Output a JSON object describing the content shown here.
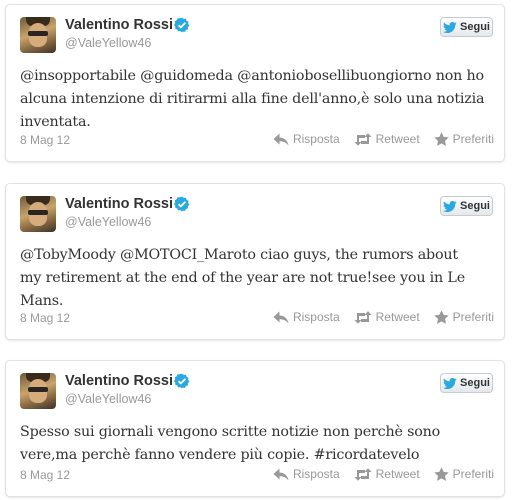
{
  "colors": {
    "name": "#333333",
    "handle": "#999999",
    "verified": "#2aa9e0",
    "bird": "#2aa9e0",
    "action": "#999999",
    "card_border": "#dfe3e8"
  },
  "icons": {
    "verified": "verified-badge-icon",
    "follow": "twitter-bird-icon",
    "reply": "reply-arrow-icon",
    "retweet": "retweet-icon",
    "favorite": "star-icon"
  },
  "tweets": [
    {
      "name": "Valentino Rossi",
      "handle": "@ValeYellow46",
      "follow_label": "Segui",
      "text_lines": [
        "@insopportabile @guidomeda @antoniobosellibuongiorno non ho",
        "alcuna intenzione di ritirarmi alla fine dell'anno,è solo una notizia",
        "inventata."
      ],
      "date": "8 Mag 12",
      "reply_label": "Risposta",
      "retweet_label": "Retweet",
      "favorite_label": "Preferiti"
    },
    {
      "name": "Valentino Rossi",
      "handle": "@ValeYellow46",
      "follow_label": "Segui",
      "text_lines": [
        "@TobyMoody @MOTOCI_Maroto ciao guys, the rumors about",
        "my retirement at the end of the year are not true!see you in Le",
        "Mans."
      ],
      "date": "8 Mag 12",
      "reply_label": "Risposta",
      "retweet_label": "Retweet",
      "favorite_label": "Preferiti"
    },
    {
      "name": "Valentino Rossi",
      "handle": "@ValeYellow46",
      "follow_label": "Segui",
      "text_lines": [
        "Spesso sui giornali vengono scritte notizie non perchè sono",
        "vere,ma perchè fanno vendere più copie. #ricordatevelo"
      ],
      "date": "8 Mag 12",
      "reply_label": "Risposta",
      "retweet_label": "Retweet",
      "favorite_label": "Preferiti"
    }
  ]
}
